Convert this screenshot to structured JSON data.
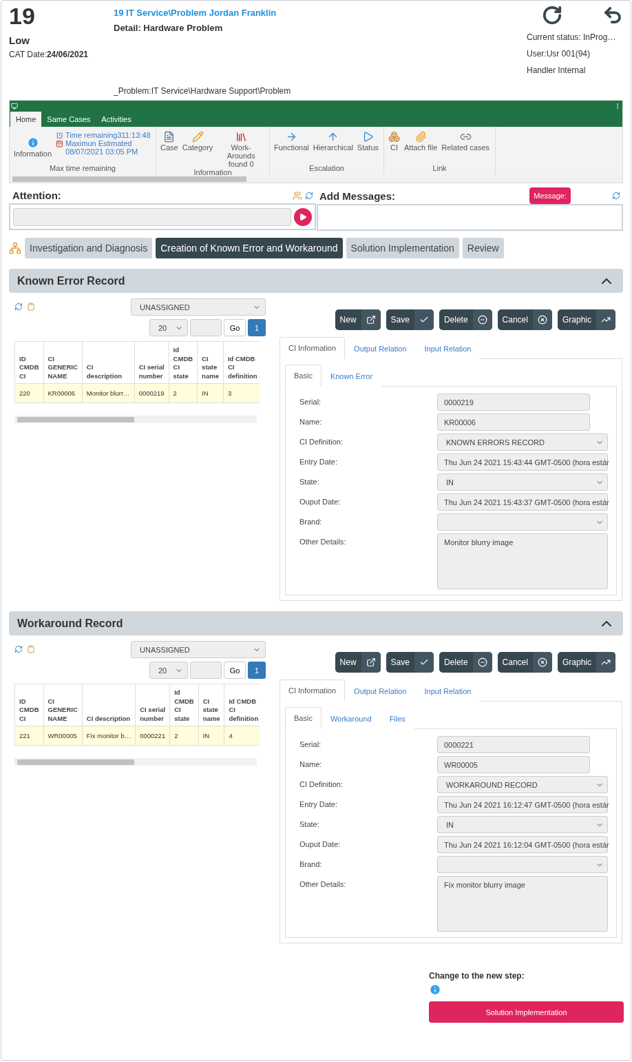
{
  "header": {
    "number": "19",
    "priority": "Low",
    "cat_date_label": "CAT Date:",
    "cat_date": "24/06/2021",
    "title": "19 IT Service\\Problem Jordan Franklin",
    "detail": "Detail: Hardware Problem",
    "path": "_Problem:IT Service\\Hardware Support\\Problem",
    "status": "Current status: InProg…",
    "user": "User:Usr 001(94)",
    "handler": "Handler Internal"
  },
  "ribbon": {
    "tabs": [
      {
        "label": "Home",
        "selected": true
      },
      {
        "label": "Same Cases",
        "selected": false
      },
      {
        "label": "Activities",
        "selected": false
      }
    ],
    "info": {
      "label": "Information",
      "time_remaining": "Time remaining311:13:48",
      "estimated": "Maximun Estimated",
      "estimated_date": "08/07/2021 03:05 PM",
      "group": "Max time remaining"
    },
    "groups": [
      {
        "label": "Information",
        "items": [
          "Case",
          "Category",
          "Work-Arounds found 0"
        ]
      },
      {
        "label": "Escalation",
        "items": [
          "Functional",
          "Hierarchical",
          "Status"
        ]
      },
      {
        "label": "Link",
        "items": [
          "CI",
          "Attach file",
          "Related cases"
        ]
      }
    ]
  },
  "attention": {
    "label": "Attention:"
  },
  "messages": {
    "label": "Add Messages:",
    "badge": "Message:"
  },
  "steps": [
    {
      "label": "Investigation and Diagnosis",
      "selected": false
    },
    {
      "label": "Creation of Known Error and Workaround",
      "selected": true
    },
    {
      "label": "Solution Implementation",
      "selected": false
    },
    {
      "label": "Review",
      "selected": false
    }
  ],
  "sections": [
    {
      "title": "Known Error Record",
      "expanded": true,
      "assign": "UNASSIGNED",
      "page_size": "20",
      "go": "Go",
      "page": "1",
      "columns": [
        "ID CMDB CI",
        "CI GENERIC NAME",
        "CI description",
        "CI serial number",
        "Id CMDB CI state",
        "CI state name",
        "Id CMDB CI definition"
      ],
      "rows": [
        {
          "selected": true,
          "cells": [
            "220",
            "KR00006",
            "Monitor blurr…",
            "0000219",
            "2",
            "IN",
            "3"
          ]
        }
      ],
      "buttons": [
        "New",
        "Save",
        "Delete",
        "Cancel",
        "Graphic"
      ],
      "tabs": [
        {
          "label": "CI Information",
          "selected": true
        },
        {
          "label": "Output Relation",
          "selected": false
        },
        {
          "label": "Input Relation",
          "selected": false
        }
      ],
      "subtabs": [
        {
          "label": "Basic",
          "selected": true
        },
        {
          "label": "Known Error",
          "selected": false
        }
      ],
      "fields": [
        {
          "kind": "text",
          "label": "Serial:",
          "value": "0000219"
        },
        {
          "kind": "text",
          "label": "Name:",
          "value": "KR00006"
        },
        {
          "kind": "select",
          "label": "CI Definition:",
          "value": "KNOWN ERRORS RECORD"
        },
        {
          "kind": "wide",
          "label": "Entry Date:",
          "value": "Thu Jun 24 2021 15:43:44 GMT-0500 (hora estár"
        },
        {
          "kind": "select",
          "label": "State:",
          "value": "IN"
        },
        {
          "kind": "wide",
          "label": "Ouput Date:",
          "value": "Thu Jun 24 2021 15:43:37 GMT-0500 (hora estár"
        },
        {
          "kind": "select",
          "label": "Brand:"
        },
        {
          "kind": "textarea",
          "label": "Other Details:",
          "value": "Monitor blurry image"
        }
      ]
    },
    {
      "title": "Workaround Record",
      "expanded": true,
      "assign": "UNASSIGNED",
      "page_size": "20",
      "go": "Go",
      "page": "1",
      "columns": [
        "ID CMDB CI",
        "CI GENERIC NAME",
        "CI description",
        "CI serial number",
        "Id CMDB CI state",
        "CI state name",
        "Id CMDB CI definition"
      ],
      "rows": [
        {
          "selected": true,
          "cells": [
            "221",
            "WR00005",
            "Fix monitor b…",
            "0000221",
            "2",
            "IN",
            "4"
          ]
        }
      ],
      "buttons": [
        "New",
        "Save",
        "Delete",
        "Cancel",
        "Graphic"
      ],
      "tabs": [
        {
          "label": "CI Information",
          "selected": true
        },
        {
          "label": "Output Relation",
          "selected": false
        },
        {
          "label": "Input Relation",
          "selected": false
        }
      ],
      "subtabs": [
        {
          "label": "Basic",
          "selected": true
        },
        {
          "label": "Workaround",
          "selected": false
        },
        {
          "label": "Files",
          "selected": false
        }
      ],
      "fields": [
        {
          "kind": "text",
          "label": "Serial:",
          "value": "0000221"
        },
        {
          "kind": "text",
          "label": "Name:",
          "value": "WR00005"
        },
        {
          "kind": "select",
          "label": "CI Definition:",
          "value": "WORKAROUND RECORD"
        },
        {
          "kind": "wide",
          "label": "Entry Date:",
          "value": "Thu Jun 24 2021 16:12:47 GMT-0500 (hora estár"
        },
        {
          "kind": "select",
          "label": "State:",
          "value": "IN"
        },
        {
          "kind": "wide",
          "label": "Ouput Date:",
          "value": "Thu Jun 24 2021 16:12:04 GMT-0500 (hora estár"
        },
        {
          "kind": "select",
          "label": "Brand:"
        },
        {
          "kind": "textarea",
          "label": "Other Details:",
          "value": "Fix monitor blurry image"
        }
      ]
    }
  ],
  "footer": {
    "label": "Change to the new step:",
    "button": "Solution Implementation"
  }
}
